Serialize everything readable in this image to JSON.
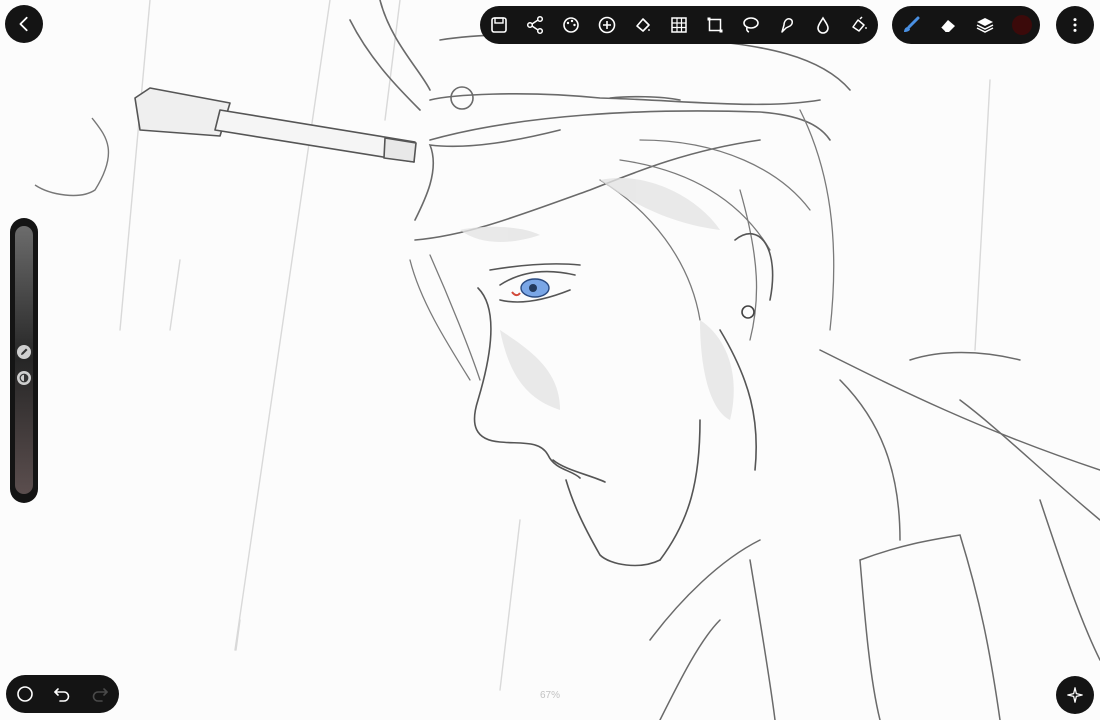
{
  "toolbar": {
    "tools": [
      "save-icon",
      "share-icon",
      "palette-icon",
      "add-layer-icon",
      "fill-icon",
      "grid-icon",
      "transform-icon",
      "lasso-icon",
      "smudge-icon",
      "blur-drop-icon",
      "paint-bucket-icon"
    ]
  },
  "brush_group": {
    "tools": [
      "brush-icon",
      "eraser-icon",
      "layers-icon"
    ],
    "active_color": "#3b0a0a",
    "accent": "#4a90e2"
  },
  "side_slider": {
    "size_level": 0.47,
    "opacity_level": 0.57
  },
  "status": {
    "zoom": "67%"
  },
  "colors": {
    "ui_dark": "#141414",
    "canvas": "#fcfcfc"
  }
}
